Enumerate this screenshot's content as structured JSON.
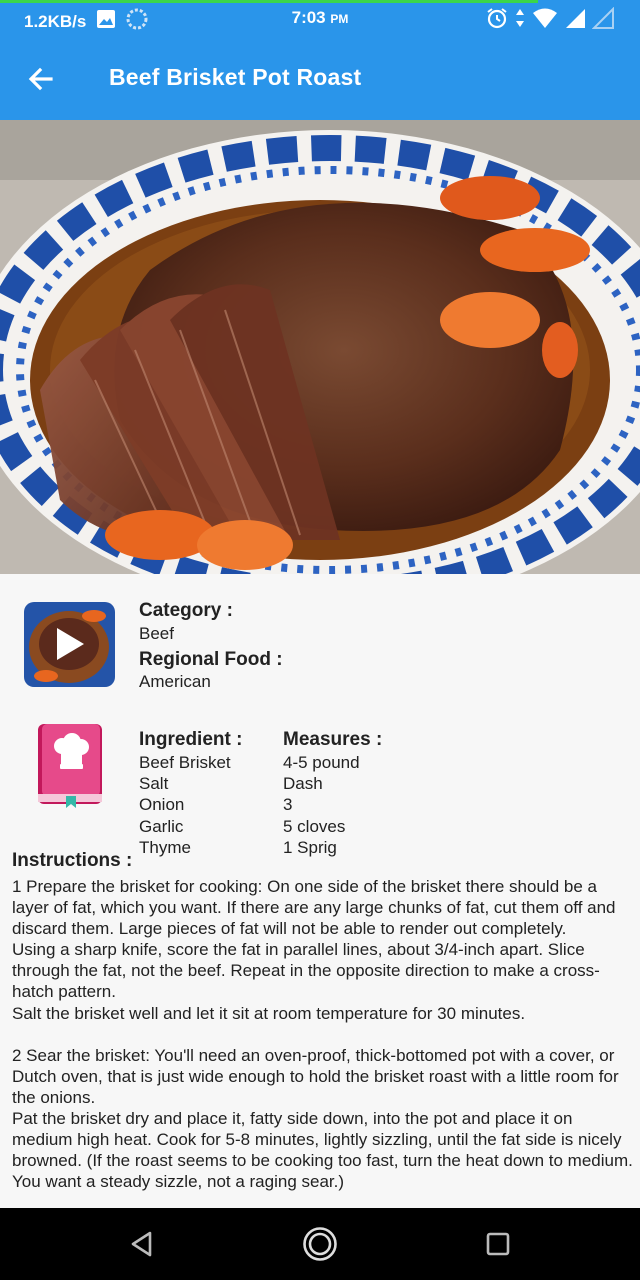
{
  "status_bar": {
    "network_speed": "1.2KB/s",
    "time": "7:03",
    "ampm": "PM",
    "icons": [
      "image-icon",
      "sync-icon",
      "alarm-icon",
      "data-arrows-icon",
      "wifi-icon",
      "signal-icon",
      "signal-empty-icon"
    ],
    "loading_progress": 0.84
  },
  "app_bar": {
    "back_icon": "arrow-back-icon",
    "title": "Beef Brisket Pot Roast"
  },
  "details": {
    "category_label": "Category :",
    "category_value": "Beef",
    "region_label": "Regional Food :",
    "region_value": "American",
    "video_thumb_icon": "play-icon",
    "ingredients_icon": "cookbook-icon",
    "ingredient_header": "Ingredient :",
    "measure_header": "Measures :",
    "ingredients": [
      {
        "name": "Beef Brisket",
        "measure": "4-5 pound"
      },
      {
        "name": "Salt",
        "measure": "Dash"
      },
      {
        "name": "Onion",
        "measure": "3"
      },
      {
        "name": "Garlic",
        "measure": "5 cloves"
      },
      {
        "name": "Thyme",
        "measure": "1 Sprig"
      }
    ]
  },
  "instructions": {
    "label": "Instructions :",
    "text": "1 Prepare the brisket for cooking: On one side of the brisket there should be a layer of fat, which you want. If there are any large chunks of fat, cut them off and discard them. Large pieces of fat will not be able to render out completely.\nUsing a sharp knife, score the fat in parallel lines, about 3/4-inch apart. Slice through the fat, not the beef. Repeat in the opposite direction to make a cross-hatch pattern.\nSalt the brisket well and let it sit at room temperature for 30 minutes.\n\n2 Sear the brisket: You'll need an oven-proof, thick-bottomed pot with a cover, or Dutch oven, that is just wide enough to hold the brisket roast with a little room for the onions.\nPat the brisket dry and place it, fatty side down, into the pot and place it on medium high heat. Cook for 5-8 minutes, lightly sizzling, until the fat side is nicely browned. (If the roast seems to be cooking too fast, turn the heat down to medium. You want a steady sizzle, not a raging sear.)"
  },
  "nav_bar": {
    "icons": [
      "nav-back-icon",
      "nav-home-icon",
      "nav-recents-icon"
    ]
  },
  "colors": {
    "primary": "#2a95ea",
    "background": "#f7f7f7",
    "progress": "#3bd64a"
  }
}
